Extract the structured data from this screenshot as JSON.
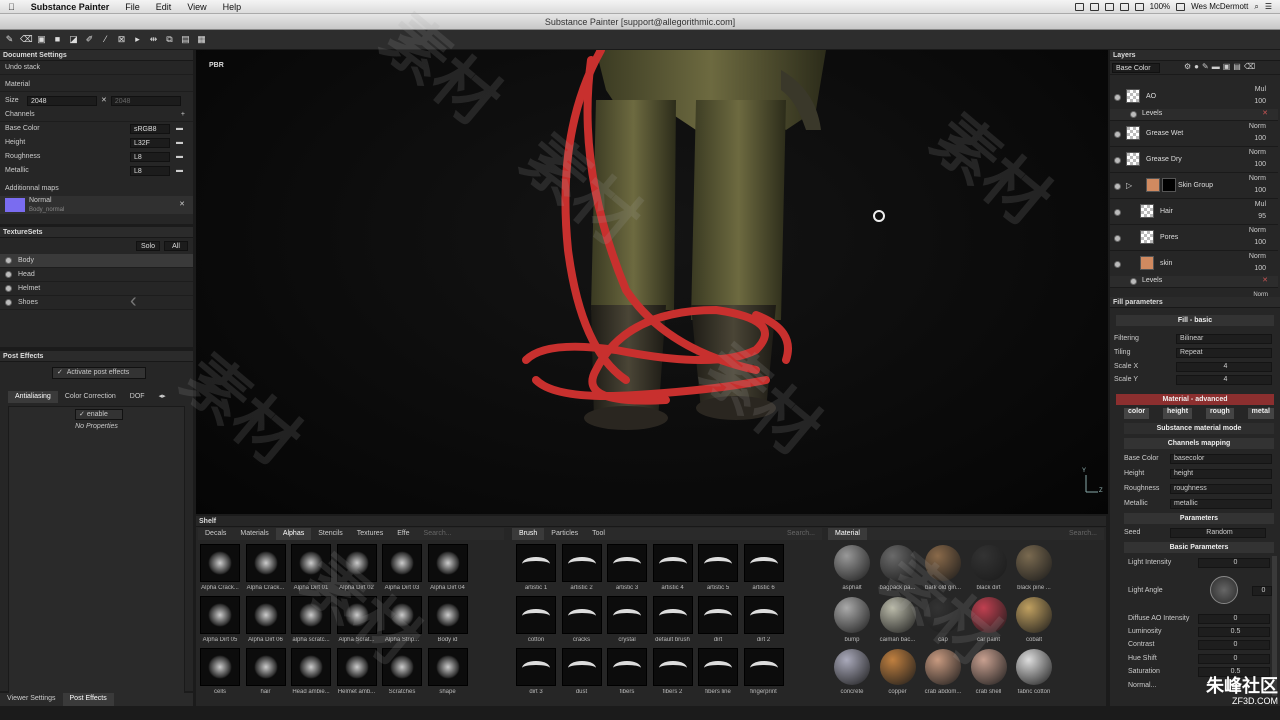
{
  "menubar": {
    "apple": "",
    "app": "Substance Painter",
    "items": [
      "File",
      "Edit",
      "View",
      "Help"
    ],
    "battery": "100%",
    "user": "Wes McDermott"
  },
  "window": {
    "title": "Substance Painter [support@allegorithmic.com]"
  },
  "document_settings": {
    "title": "Document Settings",
    "undo_stack": "Undo stack",
    "material": "Material",
    "size_label": "Size",
    "size_value": "2048",
    "size_value2": "2048",
    "channels_label": "Channels",
    "channels": [
      {
        "name": "Base Color",
        "format": "sRGB8"
      },
      {
        "name": "Height",
        "format": "L32F"
      },
      {
        "name": "Roughness",
        "format": "L8"
      },
      {
        "name": "Metallic",
        "format": "L8"
      }
    ],
    "additional_maps": "Additionnal maps",
    "normal_label": "Normal",
    "normal_sub": "Body_normal"
  },
  "texturesets": {
    "title": "TextureSets",
    "solo": "Solo",
    "all": "All",
    "items": [
      "Body",
      "Head",
      "Helmet",
      "Shoes"
    ]
  },
  "post_effects": {
    "title": "Post Effects",
    "activate": "Activate post effects",
    "tabs": [
      "Antialiasing",
      "Color Correction",
      "DOF"
    ],
    "enable": "enable",
    "no_properties": "No Properties"
  },
  "bottom_tabs": [
    "Viewer Settings",
    "Post Effects"
  ],
  "viewport": {
    "mode": "PBR",
    "axis_y": "Y",
    "axis_z": "Z"
  },
  "shelf": {
    "title": "Shelf",
    "tabs": [
      "Decals",
      "Materials",
      "Alphas",
      "Stencils",
      "Textures",
      "Effe"
    ],
    "search_placeholder": "Search...",
    "alphas": [
      "Alpha Crack...",
      "Alpha Crack...",
      "Alpha Dirt 01",
      "Alpha Dirt 02",
      "Alpha Dirt 03",
      "Alpha Dirt 04",
      "Alpha Dirt 05",
      "Alpha Dirt 06",
      "alpha scratc...",
      "Alpha Scrat...",
      "Alpha Strip...",
      "Body id",
      "cells",
      "hair",
      "Head ambie...",
      "Helmet amb...",
      "Scratches",
      "shape"
    ],
    "brush_tabs": [
      "Brush",
      "Particles",
      "Tool"
    ],
    "brushes": [
      "artistic 1",
      "artistic 2",
      "artistic 3",
      "artistic 4",
      "artistic 5",
      "artistic 6",
      "cotton",
      "cracks",
      "crystal",
      "default brush",
      "dirt",
      "dirt 2",
      "dirt 3",
      "dust",
      "fibers",
      "fibers 2",
      "fibers line",
      "fingerprint"
    ],
    "material_tab": "Material",
    "materials": [
      "asphalt",
      "bagpack pa...",
      "bark old gin...",
      "black dirt",
      "black pine ...",
      "bump",
      "caiman bac...",
      "cap",
      "car paint",
      "cobalt",
      "concrete",
      "copper",
      "crab abdom...",
      "crab shell",
      "fabric cotton"
    ]
  },
  "layers": {
    "title": "Layers",
    "channel": "Base Color",
    "items": [
      {
        "name": "AO",
        "blend": "Mul",
        "opacity": "100"
      },
      {
        "name": "Levels",
        "blend": "",
        "opacity": ""
      },
      {
        "name": "Grease Wet",
        "blend": "Norm",
        "opacity": "100"
      },
      {
        "name": "Grease Dry",
        "blend": "Norm",
        "opacity": "100"
      },
      {
        "name": "Skin Group",
        "blend": "Norm",
        "opacity": "100"
      },
      {
        "name": "Hair",
        "blend": "Mul",
        "opacity": "95"
      },
      {
        "name": "Pores",
        "blend": "Norm",
        "opacity": "100"
      },
      {
        "name": "skin",
        "blend": "Norm",
        "opacity": "100"
      },
      {
        "name": "Levels",
        "blend": "",
        "opacity": ""
      }
    ],
    "last_blend": "Norm"
  },
  "fill": {
    "title": "Fill parameters",
    "basic": "Fill - basic",
    "filtering_label": "Filtering",
    "filtering": "Bilinear",
    "tiling_label": "Tiling",
    "tiling": "Repeat",
    "scalex_label": "Scale X",
    "scalex": "4",
    "scaley_label": "Scale Y",
    "scaley": "4",
    "advanced": "Material - advanced",
    "channel_buttons": [
      "color",
      "height",
      "rough",
      "metal"
    ],
    "mode": "Substance material mode",
    "mapping": "Channels mapping",
    "map_rows": [
      {
        "label": "Base Color",
        "value": "basecolor"
      },
      {
        "label": "Height",
        "value": "height"
      },
      {
        "label": "Roughness",
        "value": "roughness"
      },
      {
        "label": "Metallic",
        "value": "metallic"
      }
    ],
    "parameters": "Parameters",
    "seed_label": "Seed",
    "seed": "Random",
    "basic_params": "Basic Parameters",
    "light_intensity_label": "Light Intensity",
    "light_intensity": "0",
    "light_angle_label": "Light Angle",
    "light_angle": "0",
    "diffuse_ao_label": "Diffuse AO Intensity",
    "diffuse_ao": "0",
    "luminosity_label": "Luminosity",
    "luminosity": "0.5",
    "contrast_label": "Contrast",
    "contrast": "0",
    "hue_label": "Hue Shift",
    "hue": "0",
    "saturation_label": "Saturation",
    "saturation": "0.5",
    "normal_label": "Normal..."
  },
  "watermark": {
    "text": "素材",
    "logo_text": "朱峰社区",
    "logo_sub": "ZF3D.COM"
  },
  "colors": {
    "accent": "#b03030",
    "normal_swatch": "#7a6cf0",
    "hose": "#c8302e"
  }
}
